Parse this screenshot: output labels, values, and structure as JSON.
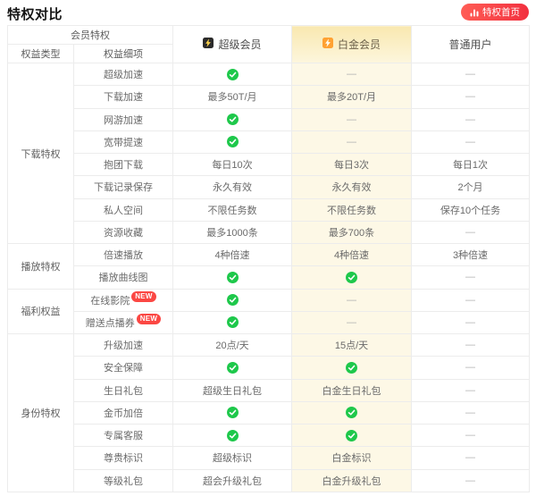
{
  "page": {
    "title": "特权对比"
  },
  "toolbar": {
    "home_button_label": "特权首页"
  },
  "table": {
    "header": {
      "member_privilege": "会员特权",
      "benefit_type": "权益类型",
      "benefit_detail": "权益细项",
      "columns": [
        {
          "key": "super",
          "label": "超级会员",
          "icon": "super-vip-badge-icon"
        },
        {
          "key": "platinum",
          "label": "白金会员",
          "icon": "platinum-vip-badge-icon"
        },
        {
          "key": "normal",
          "label": "普通用户",
          "icon": null
        }
      ]
    },
    "groups": [
      {
        "name": "下载特权",
        "rows": [
          {
            "label": "超级加速",
            "super": "check",
            "platinum": "—",
            "normal": "—"
          },
          {
            "label": "下载加速",
            "super": "最多50T/月",
            "platinum": "最多20T/月",
            "normal": "—"
          },
          {
            "label": "网游加速",
            "super": "check",
            "platinum": "—",
            "normal": "—"
          },
          {
            "label": "宽带提速",
            "super": "check",
            "platinum": "—",
            "normal": "—"
          },
          {
            "label": "抱团下载",
            "super": "每日10次",
            "platinum": "每日3次",
            "normal": "每日1次"
          },
          {
            "label": "下载记录保存",
            "super": "永久有效",
            "platinum": "永久有效",
            "normal": "2个月"
          },
          {
            "label": "私人空间",
            "super": "不限任务数",
            "platinum": "不限任务数",
            "normal": "保存10个任务"
          },
          {
            "label": "资源收藏",
            "super": "最多1000条",
            "platinum": "最多700条",
            "normal": "—"
          }
        ]
      },
      {
        "name": "播放特权",
        "rows": [
          {
            "label": "倍速播放",
            "super": "4种倍速",
            "platinum": "4种倍速",
            "normal": "3种倍速"
          },
          {
            "label": "播放曲线图",
            "super": "check",
            "platinum": "check",
            "normal": "—"
          }
        ]
      },
      {
        "name": "福利权益",
        "rows": [
          {
            "label": "在线影院",
            "badge": "NEW",
            "super": "check",
            "platinum": "—",
            "normal": "—"
          },
          {
            "label": "赠送点播券",
            "badge": "NEW",
            "super": "check",
            "platinum": "—",
            "normal": "—"
          }
        ]
      },
      {
        "name": "身份特权",
        "rows": [
          {
            "label": "升级加速",
            "super": "20点/天",
            "platinum": "15点/天",
            "normal": "—"
          },
          {
            "label": "安全保障",
            "super": "check",
            "platinum": "check",
            "normal": "—"
          },
          {
            "label": "生日礼包",
            "super": "超级生日礼包",
            "platinum": "白金生日礼包",
            "normal": "—"
          },
          {
            "label": "金币加倍",
            "super": "check",
            "platinum": "check",
            "normal": "—"
          },
          {
            "label": "专属客服",
            "super": "check",
            "platinum": "check",
            "normal": "—"
          },
          {
            "label": "尊贵标识",
            "super": "超级标识",
            "platinum": "白金标识",
            "normal": "—"
          },
          {
            "label": "等级礼包",
            "super": "超会升级礼包",
            "platinum": "白金升级礼包",
            "normal": "—"
          }
        ]
      }
    ]
  },
  "colors": {
    "accent_red": "#F2303F",
    "check_green": "#1EC84B",
    "platinum_bg": "#FDF8E6",
    "new_badge_red": "#FB4743",
    "super_badge_black": "#2B2B2B",
    "super_bolt_yellow": "#FFD34D",
    "platinum_badge_orange": "#FFA132"
  }
}
